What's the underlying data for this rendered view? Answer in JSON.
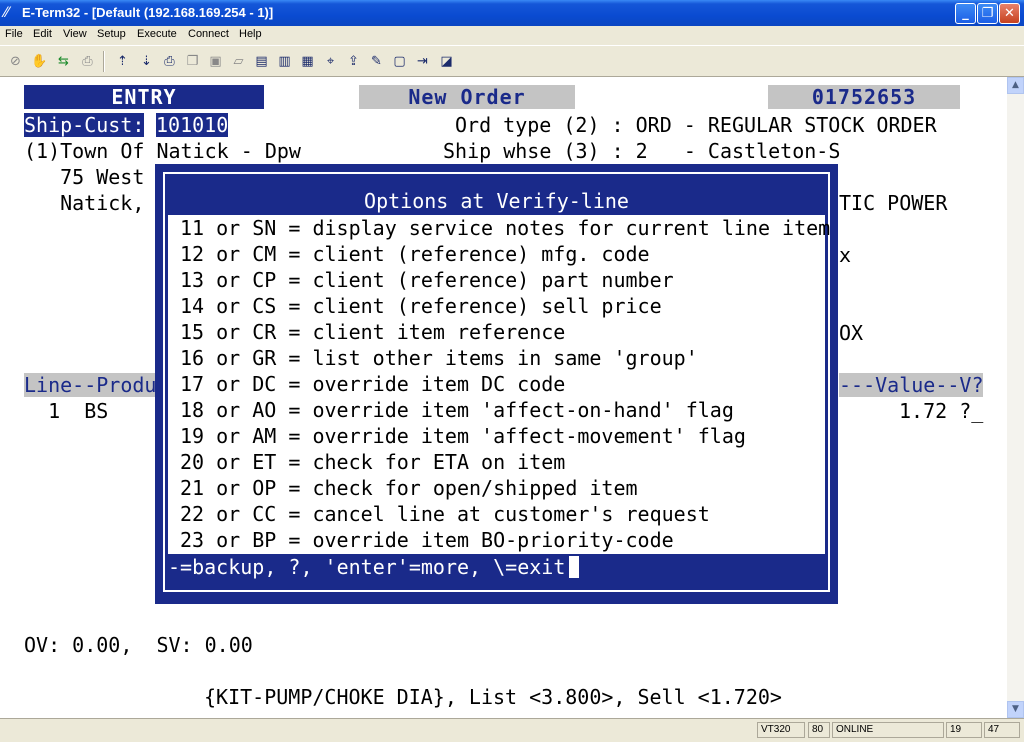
{
  "window": {
    "title": "E-Term32 - [Default (192.168.169.254 - 1)]",
    "app_icon": "eterm-icon",
    "controls": {
      "minimize": "_",
      "restore": "❐",
      "close": "✕"
    }
  },
  "menu": [
    "File",
    "Edit",
    "View",
    "Setup",
    "Execute",
    "Connect",
    "Help"
  ],
  "toolbar_icons": [
    "disconnect-icon",
    "hand-icon",
    "connect-icon",
    "print-setup-icon",
    "send-file-icon",
    "receive-file-icon",
    "print-icon",
    "copy-icon",
    "paste-icon",
    "clear-icon",
    "log-icon",
    "capture-icon",
    "keypad-icon",
    "network-icon",
    "transfer-icon",
    "script-icon",
    "macro-icon",
    "exit-icon",
    "config-icon"
  ],
  "screen": {
    "header_entry": "ENTRY",
    "header_new_order": "New Order",
    "order_number": "01752653",
    "ship_cust_label": "Ship-Cust:",
    "ship_cust_value": "101010",
    "ord_type": "Ord type (2) : ORD - REGULAR STOCK ORDER",
    "customer_name": "(1)Town Of Natick - Dpw",
    "ship_whse": "Ship whse (3) : 2   - Castleton-S",
    "address1": "  75 West",
    "address2": "  Natick,",
    "right_fragment1": "TIC POWER",
    "right_fragment2": "x",
    "right_fragment3": "OX",
    "line_header_left": "Line--Produ",
    "line_header_right": "---Value--V?",
    "line1_left": "  1  BS",
    "line1_right": "1.72 ?_",
    "ov_sv": "OV: 0.00,  SV: 0.00",
    "item_desc": "{KIT-PUMP/CHOKE DIA}, List <3.800>, Sell <1.720>"
  },
  "dialog": {
    "title": "Options at Verify-line",
    "options": [
      "11 or SN = display service notes for current line item",
      "12 or CM = client (reference) mfg. code",
      "13 or CP = client (reference) part number",
      "14 or CS = client (reference) sell price",
      "15 or CR = client item reference",
      "16 or GR = list other items in same 'group'",
      "17 or DC = override item DC code",
      "18 or AO = override item 'affect-on-hand' flag",
      "19 or AM = override item 'affect-movement' flag",
      "20 or ET = check for ETA on item",
      "21 or OP = check for open/shipped item",
      "22 or CC = cancel line at customer's request",
      "23 or BP = override item BO-priority-code"
    ],
    "footer": "-=backup, ?, 'enter'=more, \\=exit"
  },
  "status": {
    "emulation": "VT320",
    "columns": "80",
    "connection": "ONLINE",
    "row": "19",
    "col": "47"
  },
  "colors": {
    "terminal_blue": "#1a2a8a",
    "highlight_gray": "#c4c4c4",
    "titlebar_blue": "#0a4bd1"
  }
}
